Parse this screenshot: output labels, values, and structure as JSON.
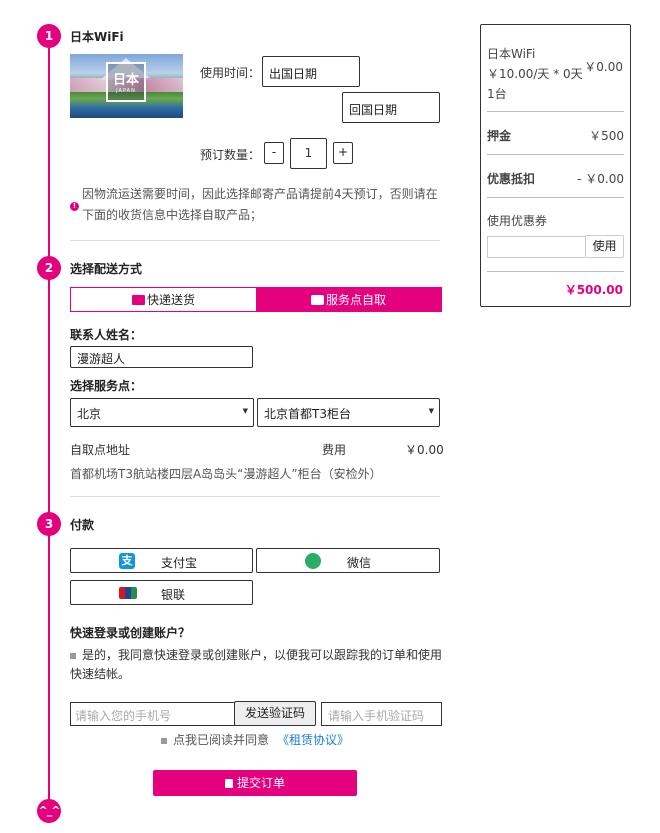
{
  "steps": [
    "1",
    "2",
    "3",
    "^_^"
  ],
  "product": {
    "title": "日本WiFi",
    "image_badge": "日本",
    "image_caption": "JAPAN",
    "use_time_label": "使用时间：",
    "depart_placeholder": "出国日期",
    "return_placeholder": "回国日期",
    "qty_label": "预订数量：",
    "qty_minus": "-",
    "qty_value": "1",
    "qty_plus": "+",
    "notice_icon": "!",
    "notice": "因物流运送需要时间，因此选择邮寄产品请提前4天预订，否则请在下面的收货信息中选择自取产品；"
  },
  "delivery": {
    "title": "选择配送方式",
    "tabs": [
      {
        "label": "快递送货",
        "icon": "truck-icon",
        "active": false
      },
      {
        "label": "服务点自取",
        "icon": "bag-icon",
        "active": true
      }
    ],
    "contact_label": "联系人姓名：",
    "contact_value": "漫游超人",
    "service_label": "选择服务点：",
    "city": "北京",
    "point": "北京首都T3柜台",
    "pickup_address_label": "自取点地址",
    "fee_label": "费用",
    "fee_value": "￥0.00",
    "address": "首都机场T3航站楼四层A岛岛头“漫游超人”柜台（安检外）"
  },
  "payment": {
    "title": "付款",
    "methods": [
      {
        "label": "支付宝",
        "icon": "alipay-icon"
      },
      {
        "label": "微信",
        "icon": "wechat-icon"
      },
      {
        "label": "银联",
        "icon": "unionpay-icon"
      }
    ],
    "account_title": "快速登录或创建账户？",
    "account_consent": "是的，我同意快速登录或创建账户，以便我可以跟踪我的订单和使用快速结帐。",
    "phone_placeholder": "请输入您的手机号",
    "send_code": "发送验证码",
    "code_placeholder": "请输入手机验证码",
    "agree_text": "点我已阅读并同意",
    "agree_link": "《租赁协议》",
    "submit": "提交订单"
  },
  "summary": {
    "item_name": "日本WiFi",
    "item_price": "￥10.00/天 * 0天",
    "item_qty": "1台",
    "item_total": "￥0.00",
    "deposit_label": "押金",
    "deposit_value": "￥500",
    "discount_label": "优惠抵扣",
    "discount_value": "- ￥0.00",
    "coupon_label": "使用优惠券",
    "coupon_button": "使用",
    "total": "￥500.00"
  },
  "colors": {
    "accent": "#e5007e",
    "link": "#1a7fd4"
  }
}
